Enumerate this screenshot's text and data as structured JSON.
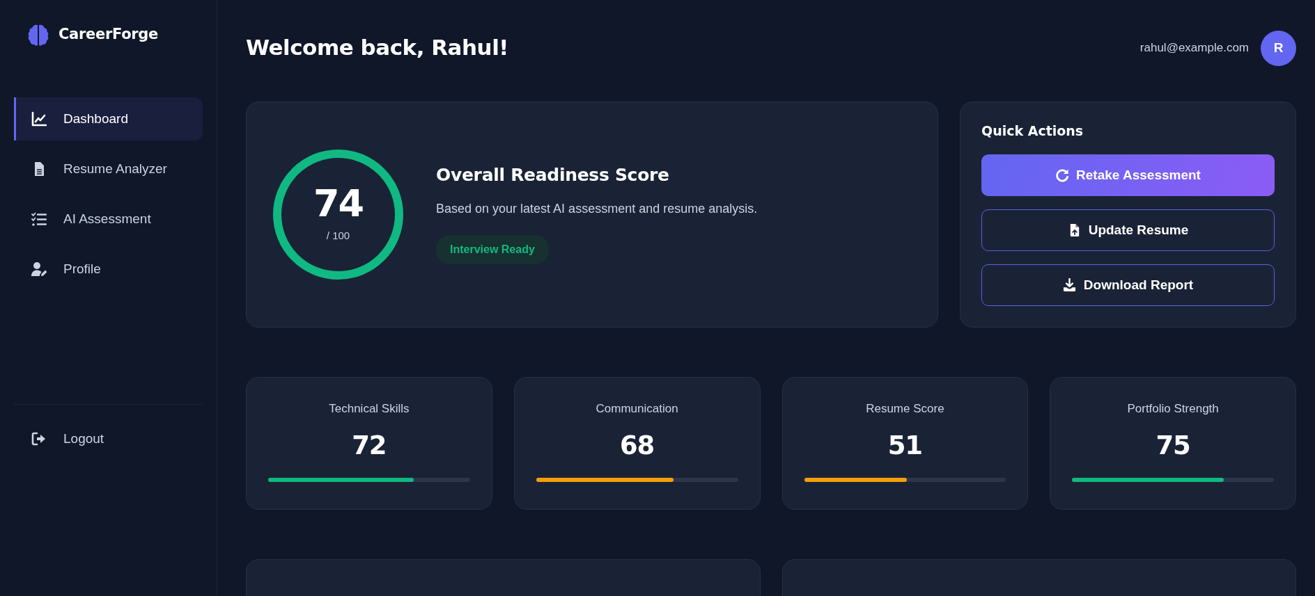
{
  "sidebar": {
    "brand": "CareerForge",
    "items": [
      {
        "label": "Dashboard",
        "selected": true
      },
      {
        "label": "Resume Analyzer",
        "selected": false
      },
      {
        "label": "AI Assessment",
        "selected": false
      },
      {
        "label": "Profile",
        "selected": false
      }
    ],
    "logout": "Logout"
  },
  "header": {
    "title": "Welcome back, Rahul!",
    "email": "rahul@example.com",
    "avatar": "R"
  },
  "readiness": {
    "score": "74",
    "out_of": "/ 100",
    "title": "Overall Readiness Score",
    "description": "Based on your latest AI assessment and resume analysis.",
    "badge": "Interview Ready"
  },
  "quick_actions": {
    "title": "Quick Actions",
    "buttons": [
      {
        "label": "Retake Assessment",
        "kind": "primary"
      },
      {
        "label": "Update Resume",
        "kind": "outline"
      },
      {
        "label": "Download Report",
        "kind": "outline"
      }
    ]
  },
  "stats": [
    {
      "label": "Technical Skills",
      "value": "72",
      "level": 0.72,
      "color": "#10b981"
    },
    {
      "label": "Communication",
      "value": "68",
      "level": 0.68,
      "color": "#f59e0b"
    },
    {
      "label": "Resume Score",
      "value": "51",
      "level": 0.51,
      "color": "#f59e0b"
    },
    {
      "label": "Portfolio Strength",
      "value": "75",
      "level": 0.75,
      "color": "#10b981"
    }
  ]
}
